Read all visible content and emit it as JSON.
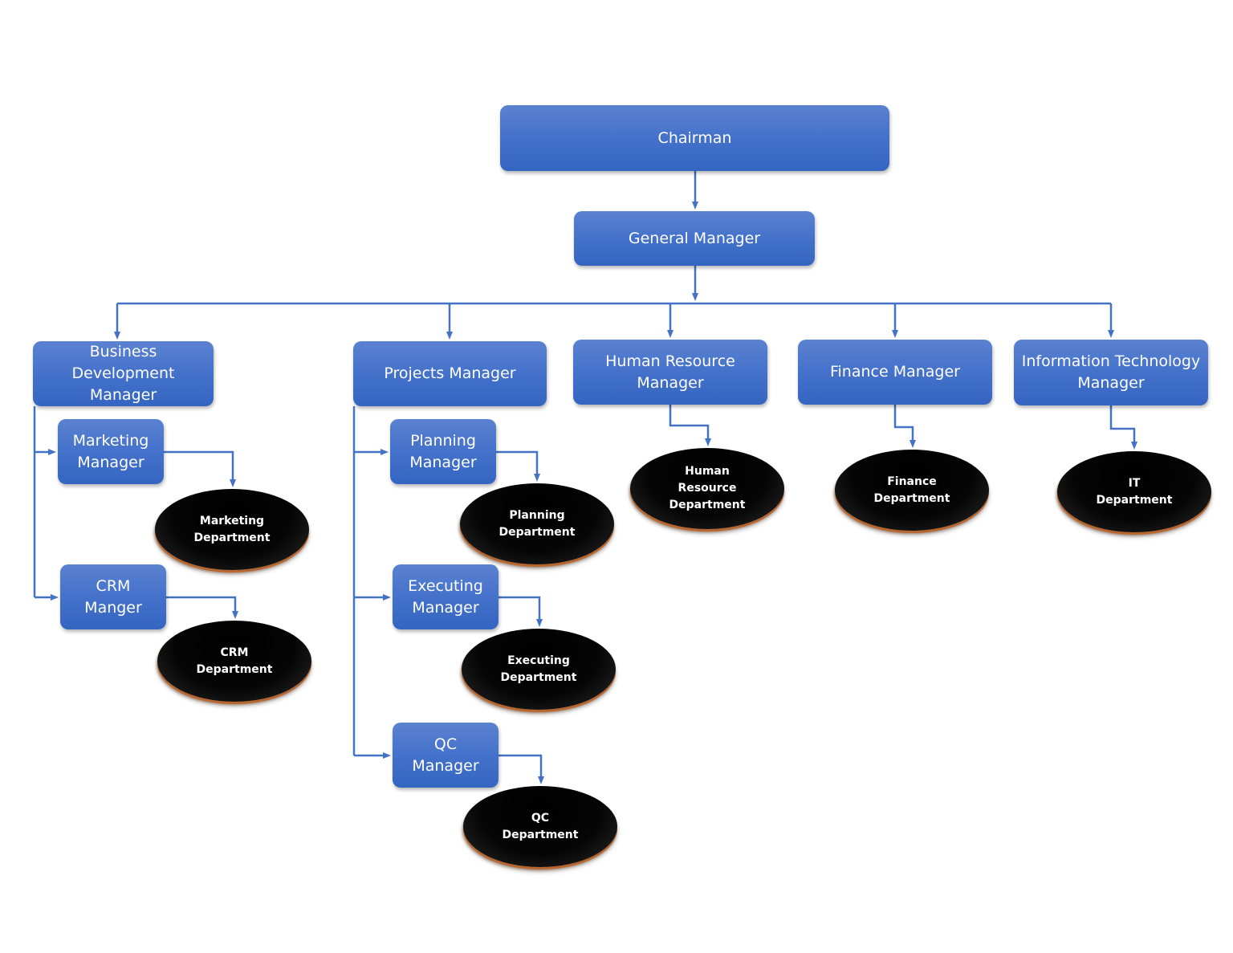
{
  "diagram": {
    "type": "org-chart",
    "connector_color": "#4472c4",
    "box_color": "#4472c4",
    "department_color": "#000000",
    "nodes": {
      "chairman": "Chairman",
      "general_manager": "General Manager",
      "business_development_manager": "Business\nDevelopment\nManager",
      "projects_manager": "Projects Manager",
      "human_resource_manager": "Human Resource\nManager",
      "finance_manager": "Finance Manager",
      "it_manager": "Information Technology\nManager",
      "marketing_manager": "Marketing\nManager",
      "crm_manager": "CRM\nManger",
      "planning_manager": "Planning\nManager",
      "executing_manager": "Executing\nManager",
      "qc_manager": "QC\nManager"
    },
    "departments": {
      "marketing": "Marketing\nDepartment",
      "crm": "CRM\nDepartment",
      "planning": "Planning\nDepartment",
      "executing": "Executing\nDepartment",
      "qc": "QC\nDepartment",
      "human_resource": "Human\nResource\nDepartment",
      "finance": "Finance\nDepartment",
      "it": "IT\nDepartment"
    },
    "edges": [
      [
        "Chairman",
        "General Manager"
      ],
      [
        "General Manager",
        "Business Development Manager"
      ],
      [
        "General Manager",
        "Projects Manager"
      ],
      [
        "General Manager",
        "Human Resource Manager"
      ],
      [
        "General Manager",
        "Finance Manager"
      ],
      [
        "General Manager",
        "Information Technology Manager"
      ],
      [
        "Business Development Manager",
        "Marketing Manager"
      ],
      [
        "Business Development Manager",
        "CRM Manger"
      ],
      [
        "Marketing Manager",
        "Marketing Department"
      ],
      [
        "CRM Manger",
        "CRM Department"
      ],
      [
        "Projects Manager",
        "Planning Manager"
      ],
      [
        "Projects Manager",
        "Executing Manager"
      ],
      [
        "Projects Manager",
        "QC Manager"
      ],
      [
        "Planning Manager",
        "Planning Department"
      ],
      [
        "Executing Manager",
        "Executing Department"
      ],
      [
        "QC Manager",
        "QC Department"
      ],
      [
        "Human Resource Manager",
        "Human Resource Department"
      ],
      [
        "Finance Manager",
        "Finance Department"
      ],
      [
        "Information Technology Manager",
        "IT Department"
      ]
    ]
  }
}
